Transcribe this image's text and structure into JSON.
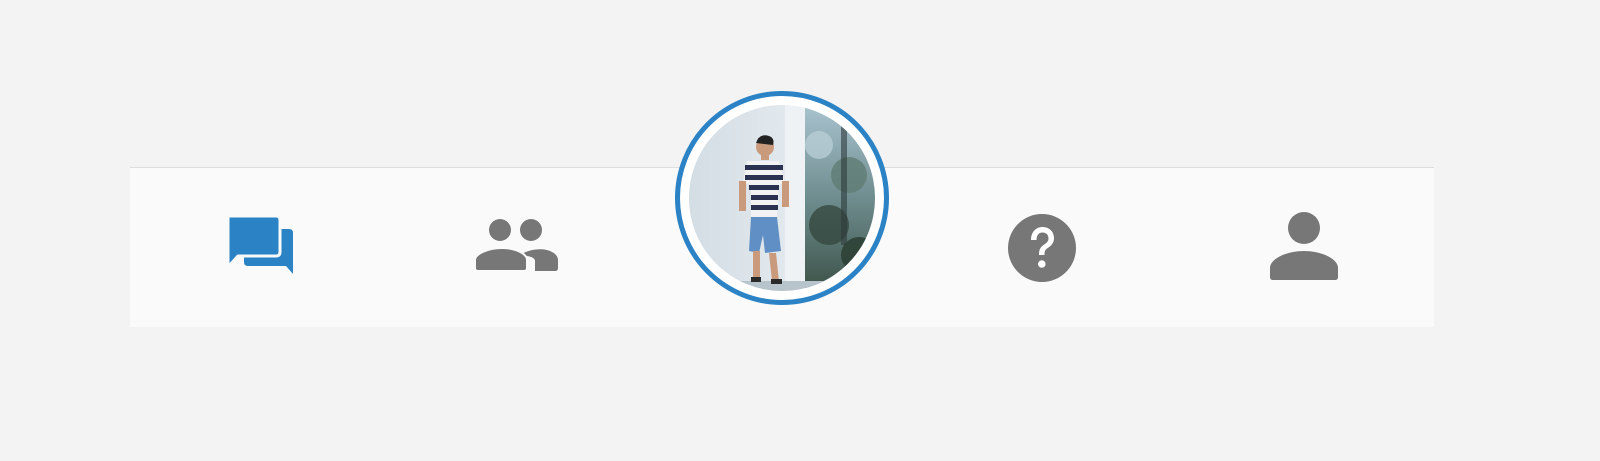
{
  "colors": {
    "accent": "#2b83c6",
    "icon_inactive": "#777777",
    "tabbar_background": "#fafafa",
    "page_background": "#f3f3f3"
  },
  "tabbar": {
    "active_tab": "chat",
    "tabs": [
      {
        "id": "chat",
        "icon": "chat-bubbles-icon",
        "active": true
      },
      {
        "id": "friends",
        "icon": "people-icon",
        "active": false
      },
      {
        "id": "profile-photo",
        "icon": "avatar",
        "active": false
      },
      {
        "id": "help",
        "icon": "help-circle-icon",
        "active": false
      },
      {
        "id": "account",
        "icon": "person-icon",
        "active": false
      }
    ]
  }
}
